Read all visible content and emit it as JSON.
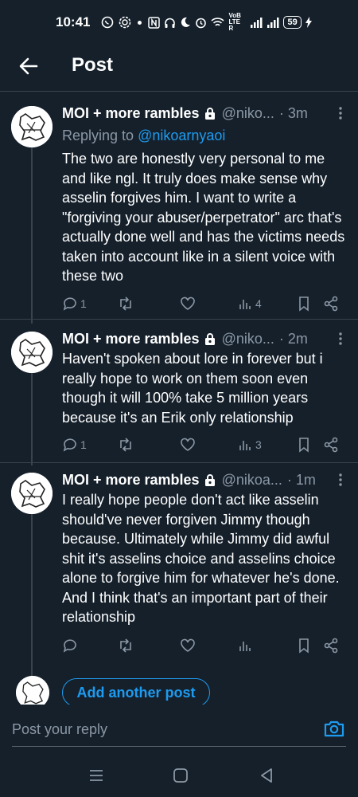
{
  "status_bar": {
    "time": "10:41",
    "network": "VoB LTE R",
    "battery": "59"
  },
  "header": {
    "title": "Post"
  },
  "posts": [
    {
      "author": "MOI + more rambles",
      "handle": "@niko...",
      "time": "· 3m",
      "replying_to_prefix": "Replying to ",
      "replying_to": "@nikoarnyaoi",
      "text": "The two are honestly very personal to me and like ngl. It truly does make sense why asselin forgives him. I want to write a \"forgiving your abuser/perpetrator\" arc that's actually done well and has the victims needs taken into account like in a silent voice with these two",
      "replies": "1",
      "reposts": "",
      "likes": "",
      "views": "4"
    },
    {
      "author": "MOI + more rambles",
      "handle": "@niko...",
      "time": "· 2m",
      "text": "Haven't spoken about lore in forever but i really hope to work on them soon even though it will 100% take 5 million years because it's an Erik only relationship",
      "replies": "1",
      "reposts": "",
      "likes": "",
      "views": "3"
    },
    {
      "author": "MOI + more rambles",
      "handle": "@nikoa...",
      "time": "· 1m",
      "text": "I really hope people don't act like asselin should've never forgiven Jimmy though because. Ultimately while Jimmy did awful shit it's asselins choice and asselins choice alone to forgive him for whatever he's done. And I think that's an important part of their relationship",
      "replies": "",
      "reposts": "",
      "likes": "",
      "views": ""
    }
  ],
  "add_another_post": "Add another post",
  "reply": {
    "placeholder": "Post your reply"
  },
  "colors": {
    "background": "#15202b",
    "accent": "#1d9bf0",
    "muted": "#8b98a5",
    "divider": "#38444d"
  },
  "icons": [
    "whatsapp-icon",
    "signal-icon",
    "nfc-icon",
    "headphones-icon",
    "moon-icon",
    "alarm-icon",
    "wifi-icon",
    "battery-icon",
    "back-arrow-icon",
    "lock-icon",
    "more-icon",
    "reply-icon",
    "repost-icon",
    "like-icon",
    "views-icon",
    "bookmark-icon",
    "share-icon",
    "camera-icon",
    "menu-icon",
    "home-icon",
    "back-icon"
  ]
}
